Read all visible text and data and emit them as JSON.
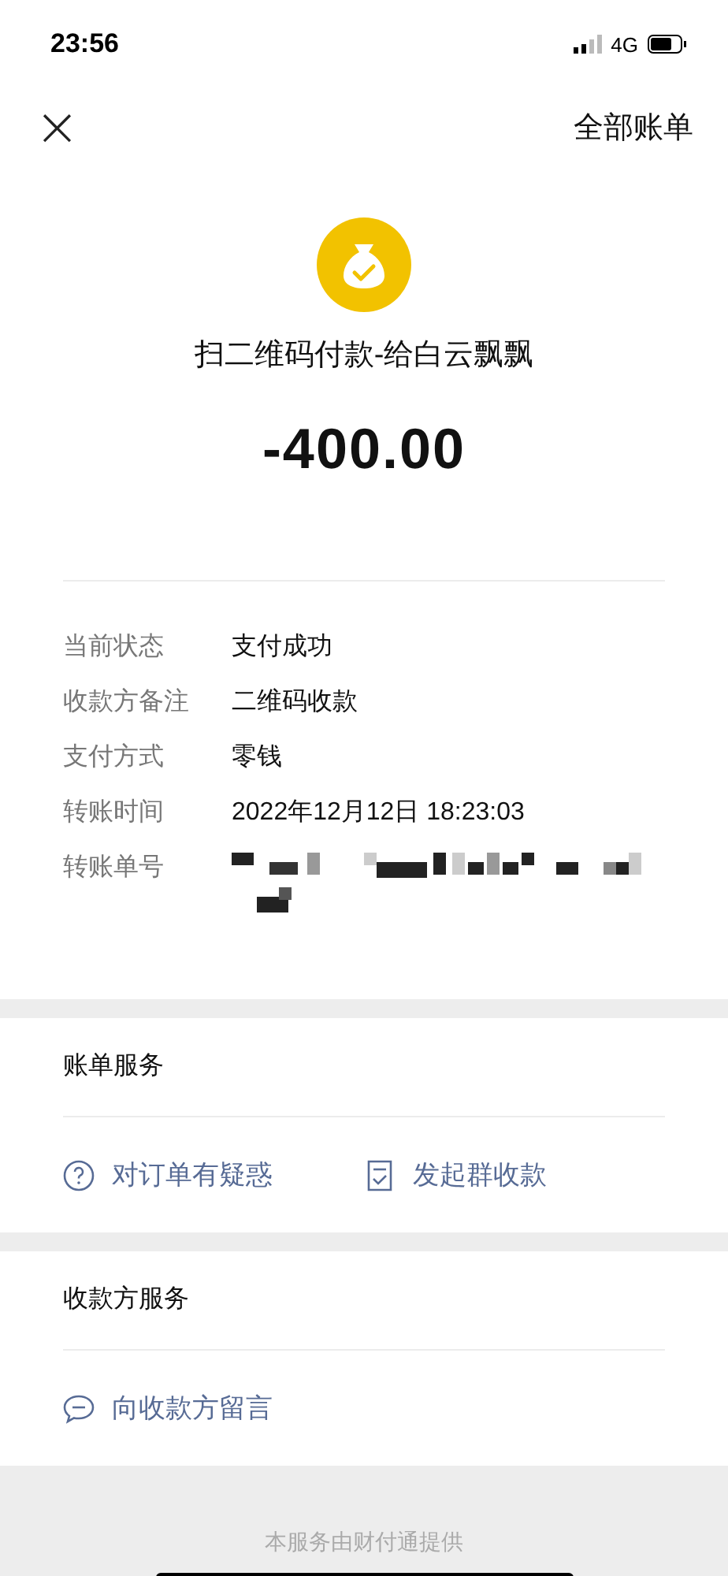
{
  "status_bar": {
    "time": "23:56",
    "network": "4G"
  },
  "nav": {
    "close": "×",
    "right": "全部账单"
  },
  "header": {
    "title": "扫二维码付款-给白云飘飘",
    "amount": "-400.00"
  },
  "details": [
    {
      "label": "当前状态",
      "value": "支付成功"
    },
    {
      "label": "收款方备注",
      "value": "二维码收款"
    },
    {
      "label": "支付方式",
      "value": "零钱"
    },
    {
      "label": "转账时间",
      "value": "2022年12月12日 18:23:03"
    },
    {
      "label": "转账单号",
      "redacted": true
    }
  ],
  "sections": [
    {
      "title": "账单服务",
      "links": [
        {
          "kind": "question",
          "label": "对订单有疑惑"
        },
        {
          "kind": "receipt",
          "label": "发起群收款"
        }
      ]
    },
    {
      "title": "收款方服务",
      "links": [
        {
          "kind": "message",
          "label": "向收款方留言"
        }
      ]
    }
  ],
  "footer": "本服务由财付通提供"
}
